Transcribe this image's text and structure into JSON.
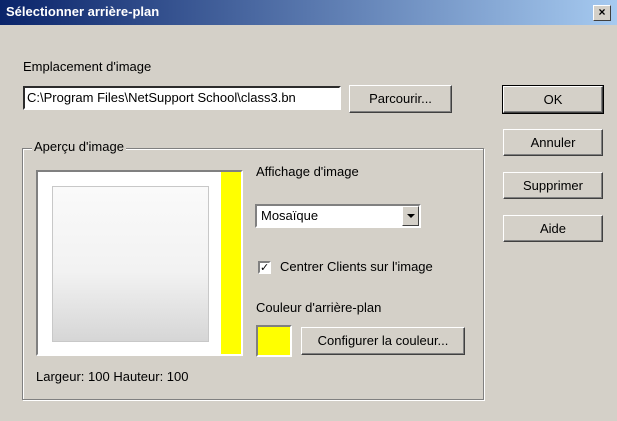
{
  "window": {
    "title": "Sélectionner arrière-plan",
    "close": "×"
  },
  "location": {
    "label": "Emplacement d'image",
    "path": "C:\\Program Files\\NetSupport School\\class3.bn",
    "browse": "Parcourir..."
  },
  "buttons": {
    "ok": "OK",
    "cancel": "Annuler",
    "delete": "Supprimer",
    "help": "Aide"
  },
  "preview": {
    "label": "Aperçu d'image",
    "size_text": "Largeur: 100   Hauteur: 100"
  },
  "display": {
    "label": "Affichage d'image",
    "selected": "Mosaïque"
  },
  "center": {
    "label": "Centrer Clients sur l'image",
    "checked": true,
    "mark": "✓"
  },
  "background": {
    "label": "Couleur d'arrière-plan",
    "configure": "Configurer la couleur...",
    "color": "#ffff00"
  }
}
